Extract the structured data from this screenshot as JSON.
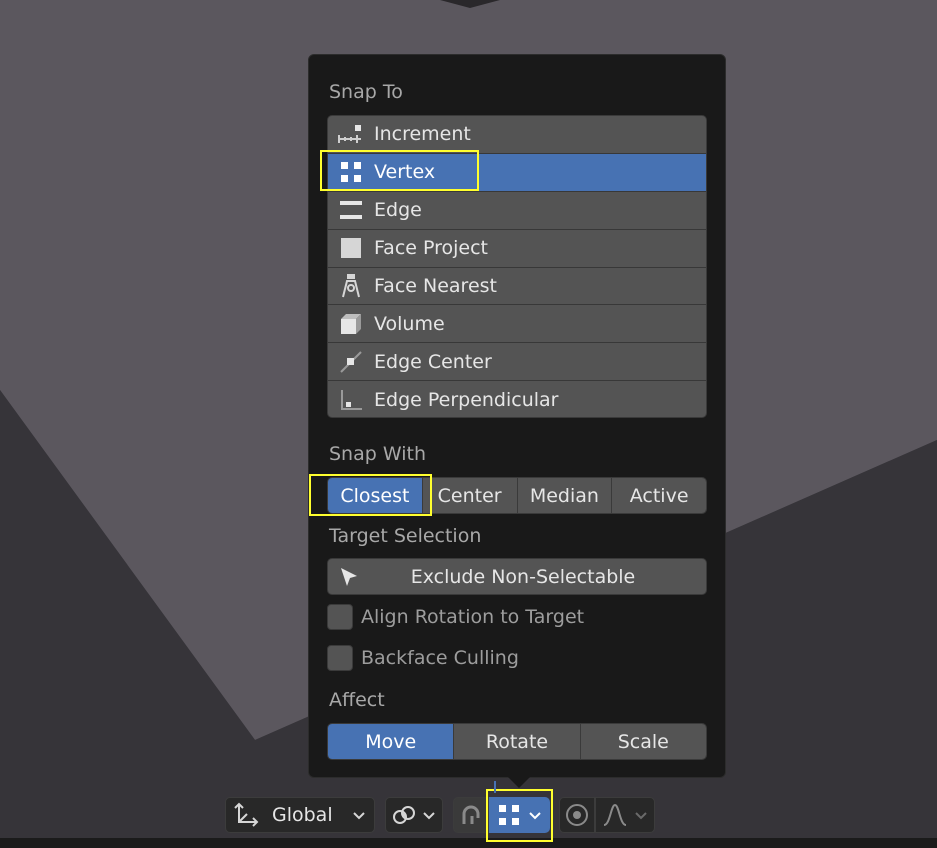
{
  "popup": {
    "snap_to_label": "Snap To",
    "snap_to_items": [
      {
        "label": "Increment",
        "icon": "increment-icon"
      },
      {
        "label": "Vertex",
        "icon": "vertex-icon",
        "selected": true
      },
      {
        "label": "Edge",
        "icon": "edge-icon"
      },
      {
        "label": "Face Project",
        "icon": "face-project-icon"
      },
      {
        "label": "Face Nearest",
        "icon": "face-nearest-icon"
      },
      {
        "label": "Volume",
        "icon": "volume-icon"
      },
      {
        "label": "Edge Center",
        "icon": "edge-center-icon"
      },
      {
        "label": "Edge Perpendicular",
        "icon": "edge-perpendicular-icon"
      }
    ],
    "snap_with_label": "Snap With",
    "snap_with_options": [
      "Closest",
      "Center",
      "Median",
      "Active"
    ],
    "snap_with_selected": "Closest",
    "target_selection_label": "Target Selection",
    "exclude_button_label": "Exclude Non-Selectable",
    "align_rotation_label": "Align Rotation to Target",
    "align_rotation_checked": false,
    "backface_culling_label": "Backface Culling",
    "backface_culling_checked": false,
    "affect_label": "Affect",
    "affect_options": [
      "Move",
      "Rotate",
      "Scale"
    ],
    "affect_selected": "Move"
  },
  "header": {
    "orientation_label": "Global"
  },
  "colors": {
    "accent": "#4772b3",
    "highlight": "#ffff2e",
    "popup_bg": "#191919",
    "button_bg": "#545454"
  }
}
